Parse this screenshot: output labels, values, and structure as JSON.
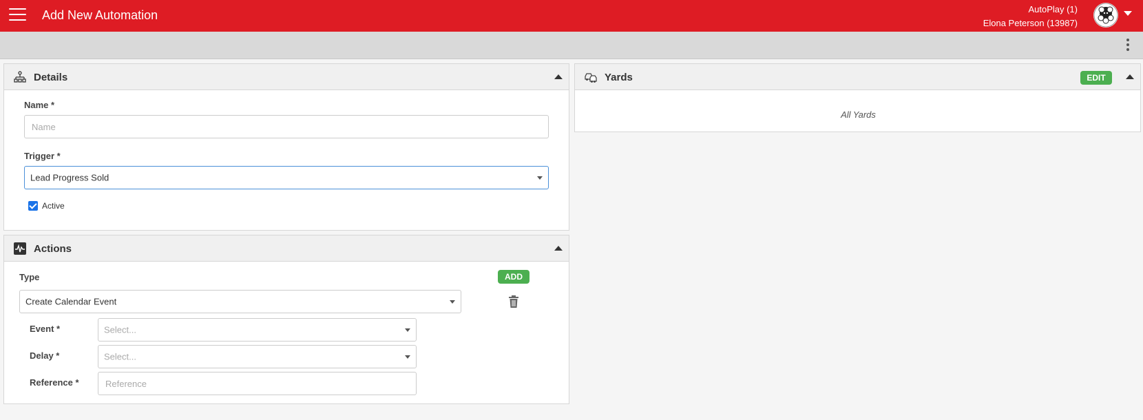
{
  "header": {
    "title": "Add New Automation",
    "account": "AutoPlay (1)",
    "user": "Elona Peterson (13987)",
    "menu_icon": "hamburger-menu-icon",
    "caret_icon": "caret-down-icon"
  },
  "toolbar": {
    "more_icon": "kebab-vertical-icon"
  },
  "details": {
    "title": "Details",
    "icon": "sitemap-icon",
    "name_label": "Name *",
    "name_placeholder": "Name",
    "trigger_label": "Trigger *",
    "trigger_value": "Lead Progress Sold",
    "active_label": "Active",
    "active_checked": true
  },
  "actions": {
    "title": "Actions",
    "icon": "activity-pulse-icon",
    "type_label": "Type",
    "add_label": "ADD",
    "type_value": "Create Calendar Event",
    "delete_icon": "trash-icon",
    "event_label": "Event *",
    "event_placeholder": "Select...",
    "delay_label": "Delay *",
    "delay_placeholder": "Select...",
    "reference_label": "Reference *",
    "reference_placeholder": "Reference"
  },
  "yards": {
    "title": "Yards",
    "icon": "cars-icon",
    "edit_label": "EDIT",
    "value": "All Yards"
  },
  "colors": {
    "brand": "#de1c24",
    "success": "#4caf50",
    "focus": "#4a8fd8"
  }
}
